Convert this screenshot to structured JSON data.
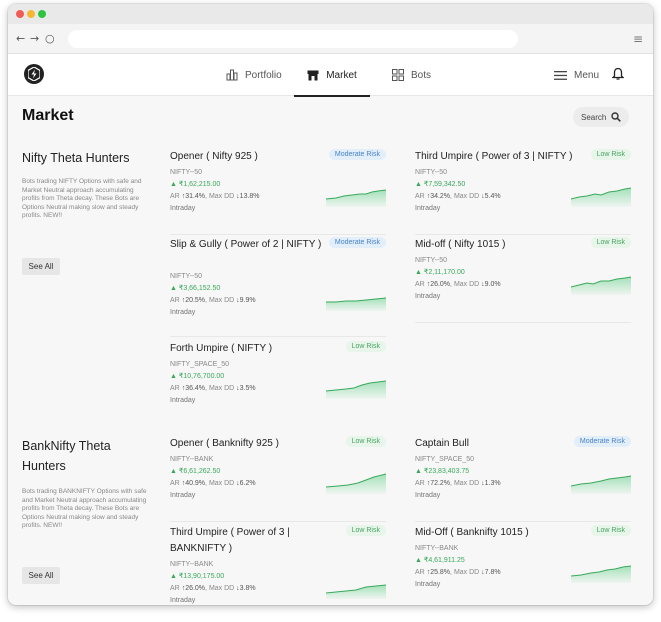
{
  "nav": {
    "portfolio": "Portfolio",
    "market": "Market",
    "bots": "Bots",
    "menu": "Menu"
  },
  "page": {
    "title": "Market",
    "search": "Search"
  },
  "colors": {
    "accent_green": "#3aa85c",
    "moderate_badge": "#4a83c4",
    "low_badge": "#4aa363"
  },
  "categories": [
    {
      "title": "Nifty Theta Hunters",
      "description": "Bots trading NIFTY Options with safe and Market Neutral approach accumulating profits from Theta decay. These Bots are Options Neutral making slow and steady profits. NEW!!",
      "see_all": "See All",
      "bots": [
        {
          "name": "Opener ( Nifty 925 )",
          "risk": "Moderate Risk",
          "index": "NIFTY--50",
          "price": "▲ ₹1,62,215.00",
          "ar": "↑31.4%",
          "maxdd": "↓13.8%",
          "type": "Intraday"
        },
        {
          "name": "Third Umpire ( Power of 3 | NIFTY )",
          "risk": "Low Risk",
          "index": "NIFTY--50",
          "price": "▲ ₹7,59,342.50",
          "ar": "↑34.2%",
          "maxdd": "↓5.4%",
          "type": "Intraday"
        },
        {
          "name": "Slip & Gully ( Power of 2 | NIFTY )",
          "risk": "Moderate Risk",
          "index": "NIFTY--50",
          "price": "▲ ₹3,66,152.50",
          "ar": "↑20.5%",
          "maxdd": "↓9.9%",
          "type": "Intraday"
        },
        {
          "name": "Mid-off ( Nifty 1015 )",
          "risk": "Low Risk",
          "index": "NIFTY--50",
          "price": "▲ ₹2,11,170.00",
          "ar": "↑26.0%",
          "maxdd": "↓9.0%",
          "type": "Intraday"
        },
        {
          "name": "Forth Umpire ( NIFTY )",
          "risk": "Low Risk",
          "index": "NIFTY_SPACE_50",
          "price": "▲ ₹10,76,700.00",
          "ar": "↑36.4%",
          "maxdd": "↓3.5%",
          "type": "Intraday"
        }
      ]
    },
    {
      "title": "BankNifty Theta Hunters",
      "description": "Bots trading BANKNIFTY Options with safe and Market Neutral approach accumulating profits from Theta decay. These Bots are Options Neutral making slow and steady profits. NEW!!",
      "see_all": "See All",
      "bots": [
        {
          "name": "Opener ( Banknifty 925 )",
          "risk": "Low Risk",
          "index": "NIFTY--BANK",
          "price": "▲ ₹6,61,262.50",
          "ar": "↑40.9%",
          "maxdd": "↓6.2%",
          "type": "Intraday"
        },
        {
          "name": "Captain Bull",
          "risk": "Moderate Risk",
          "index": "NIFTY_SPACE_50",
          "price": "▲ ₹23,83,403.75",
          "ar": "↑72.2%",
          "maxdd": "↓1.3%",
          "type": "Intraday"
        },
        {
          "name": "Third Umpire ( Power of 3 | BANKNIFTY )",
          "risk": "Low Risk",
          "index": "NIFTY--BANK",
          "price": "▲ ₹13,90,175.00",
          "ar": "↑26.0%",
          "maxdd": "↓3.8%",
          "type": "Intraday"
        },
        {
          "name": "Mid-Off ( Banknifty 1015 )",
          "risk": "Low Risk",
          "index": "NIFTY--BANK",
          "price": "▲ ₹4,61,911.25",
          "ar": "↑25.8%",
          "maxdd": "↓7.8%",
          "type": "Intraday"
        }
      ]
    }
  ],
  "labels": {
    "ar": "AR",
    "maxdd": "Max DD"
  }
}
